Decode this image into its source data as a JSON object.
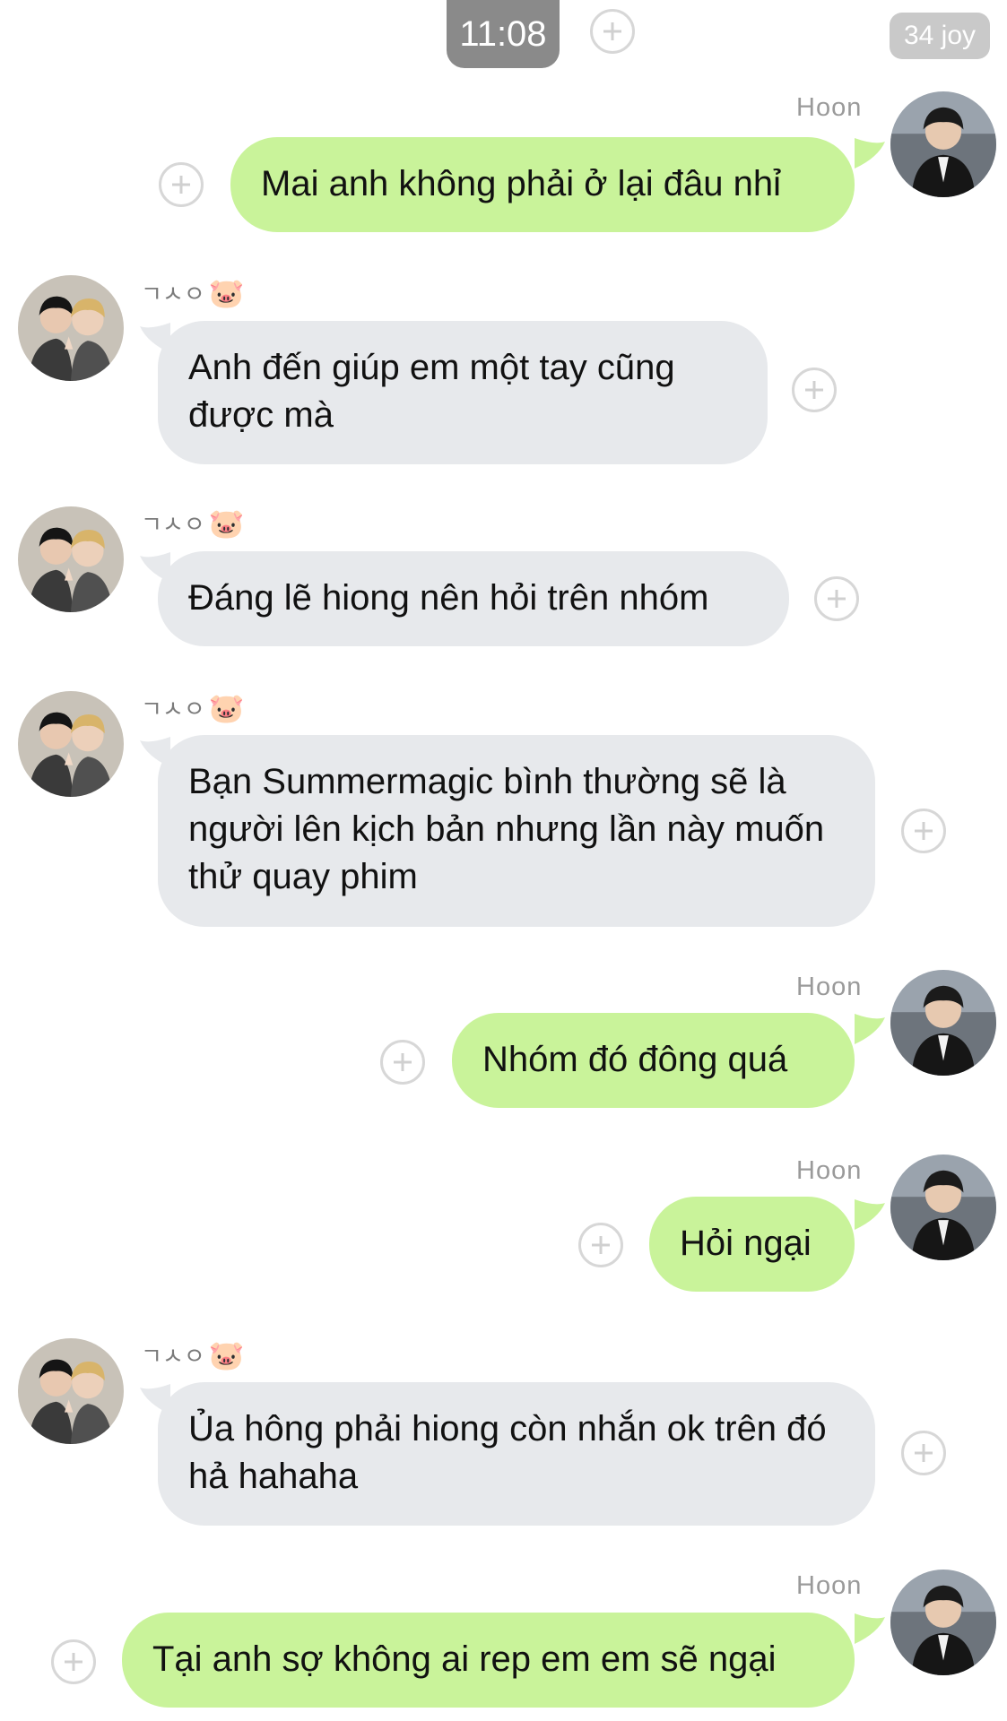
{
  "header": {
    "time": "11:08",
    "badge": "34 joy"
  },
  "me_name": "Hoon",
  "other_name": "ㄱㅅㅇ",
  "messages": [
    {
      "from": "me",
      "text": "Mai anh không phải ở lại đâu nhỉ"
    },
    {
      "from": "other",
      "text": "Anh đến giúp em một tay cũng được mà"
    },
    {
      "from": "other",
      "text": "Đáng lẽ hiong nên hỏi trên nhóm"
    },
    {
      "from": "other",
      "text": "Bạn Summermagic bình thường sẽ là người lên kịch bản nhưng lần này muốn thử quay phim"
    },
    {
      "from": "me",
      "text": "Nhóm đó đông quá"
    },
    {
      "from": "me",
      "text": "Hỏi ngại"
    },
    {
      "from": "other",
      "text": "Ủa hông phải hiong còn nhắn ok trên đó hả hahaha"
    },
    {
      "from": "me",
      "text": "Tại anh sợ không ai rep em em sẽ ngại"
    }
  ],
  "colors": {
    "my_bubble": "#c9f39a",
    "their_bubble": "#e7e9ec",
    "time_pill": "#8a8a8a"
  }
}
